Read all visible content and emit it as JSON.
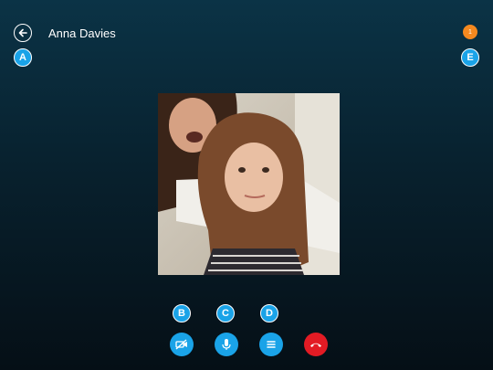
{
  "header": {
    "contact_name": "Anna Davies",
    "notification_count": "1"
  },
  "callouts": {
    "a": "A",
    "b": "B",
    "c": "C",
    "d": "D",
    "e": "E"
  },
  "controls": [
    {
      "name": "video-off",
      "icon": "video-camera-off-icon"
    },
    {
      "name": "microphone",
      "icon": "microphone-icon"
    },
    {
      "name": "more-options",
      "icon": "menu-icon"
    },
    {
      "name": "end-call",
      "icon": "hang-up-icon"
    }
  ],
  "colors": {
    "accent": "#1aa3e8",
    "badge": "#f5891f",
    "end_call": "#e31b24",
    "background_top": "#0b3346",
    "background_bottom": "#050f16"
  }
}
